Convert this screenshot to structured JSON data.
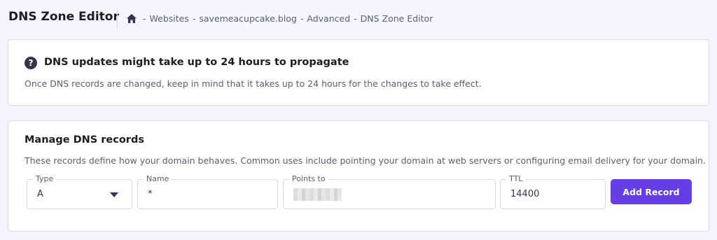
{
  "header": {
    "title": "DNS Zone Editor",
    "breadcrumb": [
      "Websites",
      "savemeacupcake.blog",
      "Advanced",
      "DNS Zone Editor"
    ],
    "separator": "-"
  },
  "notice": {
    "icon": "question-circle-icon",
    "title": "DNS updates might take up to 24 hours to propagate",
    "text": "Once DNS records are changed, keep in mind that it takes up to 24 hours for the changes to take effect."
  },
  "manage": {
    "title": "Manage DNS records",
    "description": "These records define how your domain behaves. Common uses include pointing your domain at web servers or configuring email delivery for your domain.",
    "fields": {
      "type": {
        "label": "Type",
        "value": "A"
      },
      "name": {
        "label": "Name",
        "value": "*"
      },
      "points_to": {
        "label": "Points to",
        "value": ""
      },
      "ttl": {
        "label": "TTL",
        "value": "14400"
      }
    },
    "add_button": "Add Record"
  },
  "colors": {
    "accent": "#673de6",
    "background": "#f4f5ff",
    "text_dark": "#1d1e20",
    "text_muted": "#5b5f6a"
  }
}
